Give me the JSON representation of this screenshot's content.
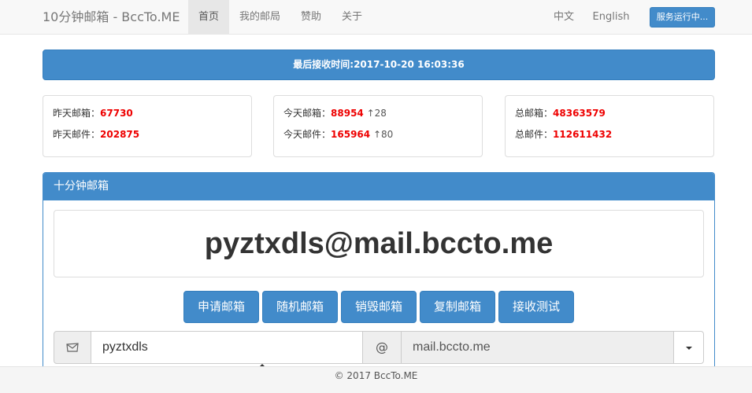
{
  "navbar": {
    "brand": "10分钟邮箱 - BccTo.ME",
    "items": [
      {
        "label": "首页"
      },
      {
        "label": "我的邮局"
      },
      {
        "label": "赞助"
      },
      {
        "label": "关于"
      }
    ],
    "lang_zh": "中文",
    "lang_en": "English",
    "status_button": "服务运行中..."
  },
  "last_receive": "最后接收时间:2017-10-20 16:03:36",
  "stats": {
    "yesterday_mailbox_label": "昨天邮箱：",
    "yesterday_mailbox_value": "67730",
    "yesterday_mail_label": "昨天邮件：",
    "yesterday_mail_value": "202875",
    "today_mailbox_label": "今天邮箱：",
    "today_mailbox_value": "88954",
    "today_mailbox_delta": "↑28",
    "today_mail_label": "今天邮件：",
    "today_mail_value": "165964",
    "today_mail_delta": "↑80",
    "total_mailbox_label": "总邮箱：",
    "total_mailbox_value": "48363579",
    "total_mail_label": "总邮件：",
    "total_mail_value": "112611432"
  },
  "main": {
    "heading": "十分钟邮箱",
    "address": "pyztxdls@mail.bccto.me",
    "buttons": {
      "apply": "申请邮箱",
      "random": "随机邮箱",
      "destroy": "销毁邮箱",
      "copy": "复制邮箱",
      "test": "接收测试"
    },
    "username": "pyztxdls",
    "at": "@",
    "domain": "mail.bccto.me"
  },
  "footer": "© 2017 BccTo.ME",
  "colors": {
    "primary": "#428bca",
    "value_red": "#e00000"
  }
}
